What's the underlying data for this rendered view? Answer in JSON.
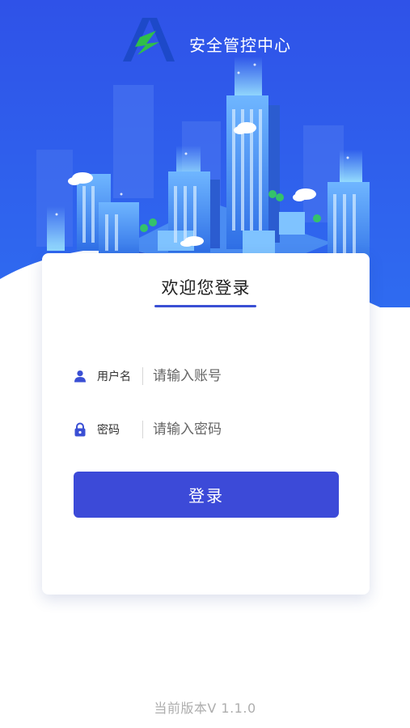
{
  "header": {
    "app_title": "安全管控中心",
    "logo_icon": "shield-s-logo",
    "brand_color": "#3a4fd4",
    "accent_green": "#2fbf4a"
  },
  "login_card": {
    "title": "欢迎您登录",
    "username": {
      "icon": "user-icon",
      "label": "用户名",
      "placeholder": "请输入账号",
      "value": ""
    },
    "password": {
      "icon": "lock-icon",
      "label": "密码",
      "placeholder": "请输入密码",
      "value": ""
    },
    "submit_label": "登录"
  },
  "footer": {
    "version": "当前版本V 1.1.0"
  }
}
